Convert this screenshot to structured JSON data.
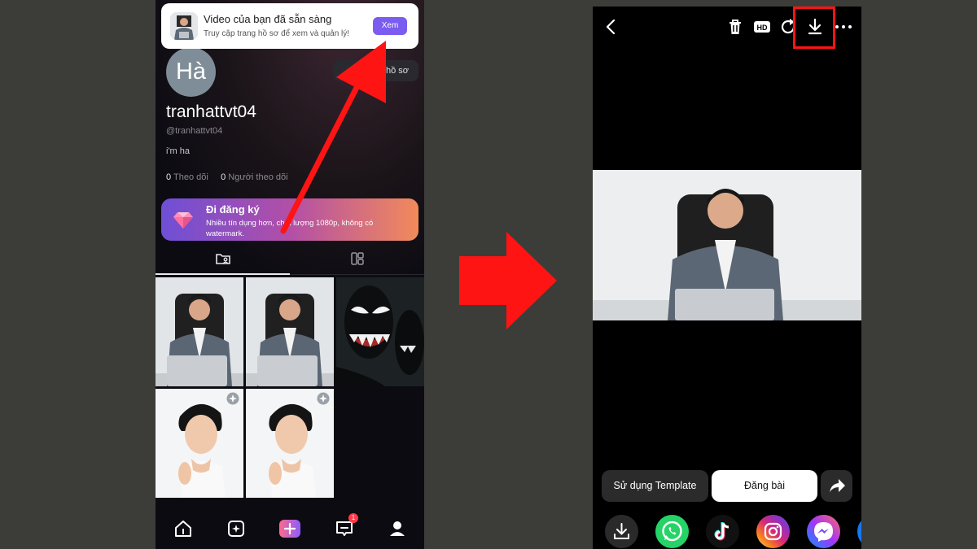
{
  "left_screen": {
    "notification": {
      "title": "Video của bạn đã sẵn sàng",
      "subtitle": "Truy cập trang hồ sơ để xem và quản lý!",
      "button": "Xem"
    },
    "profile": {
      "avatar_text": "Hà",
      "edit_button": "hồ sơ",
      "username": "tranhattvt04",
      "handle": "@tranhattvt04",
      "bio": "i'm ha",
      "followers_count": "0",
      "followers_label": "Theo dõi",
      "following_count": "0",
      "following_label": "Người theo dõi"
    },
    "promo": {
      "title": "Đi đăng ký",
      "subtitle": "Nhiều tín dụng hơn, chất lượng 1080p, không có watermark."
    },
    "tabs": [
      {
        "icon": "folder-user-icon",
        "active": true
      },
      {
        "icon": "layout-grid-icon",
        "active": false
      }
    ],
    "grid_items": [
      {
        "kind": "man-at-laptop"
      },
      {
        "kind": "man-at-laptop"
      },
      {
        "kind": "venom"
      },
      {
        "kind": "portrait",
        "ai_badge": true
      },
      {
        "kind": "portrait",
        "ai_badge": true
      }
    ],
    "bottom_nav": {
      "items": [
        "home-icon",
        "ai-studio-icon",
        "create-icon",
        "messages-icon",
        "profile-icon"
      ],
      "messages_badge": "1"
    }
  },
  "right_screen": {
    "top_bar_icons": [
      "back-icon",
      "trash-icon",
      "hd-icon",
      "refresh-icon",
      "download-icon",
      "more-icon"
    ],
    "actions": {
      "template_button": "Sử dụng Template",
      "post_button": "Đăng bài"
    },
    "share_targets": [
      "download",
      "whatsapp",
      "tiktok",
      "instagram",
      "messenger",
      "facebook"
    ]
  },
  "colors": {
    "background": "#3c3d38",
    "annotation_red": "#ff1414",
    "accent_purple": "#7a5cf0"
  }
}
